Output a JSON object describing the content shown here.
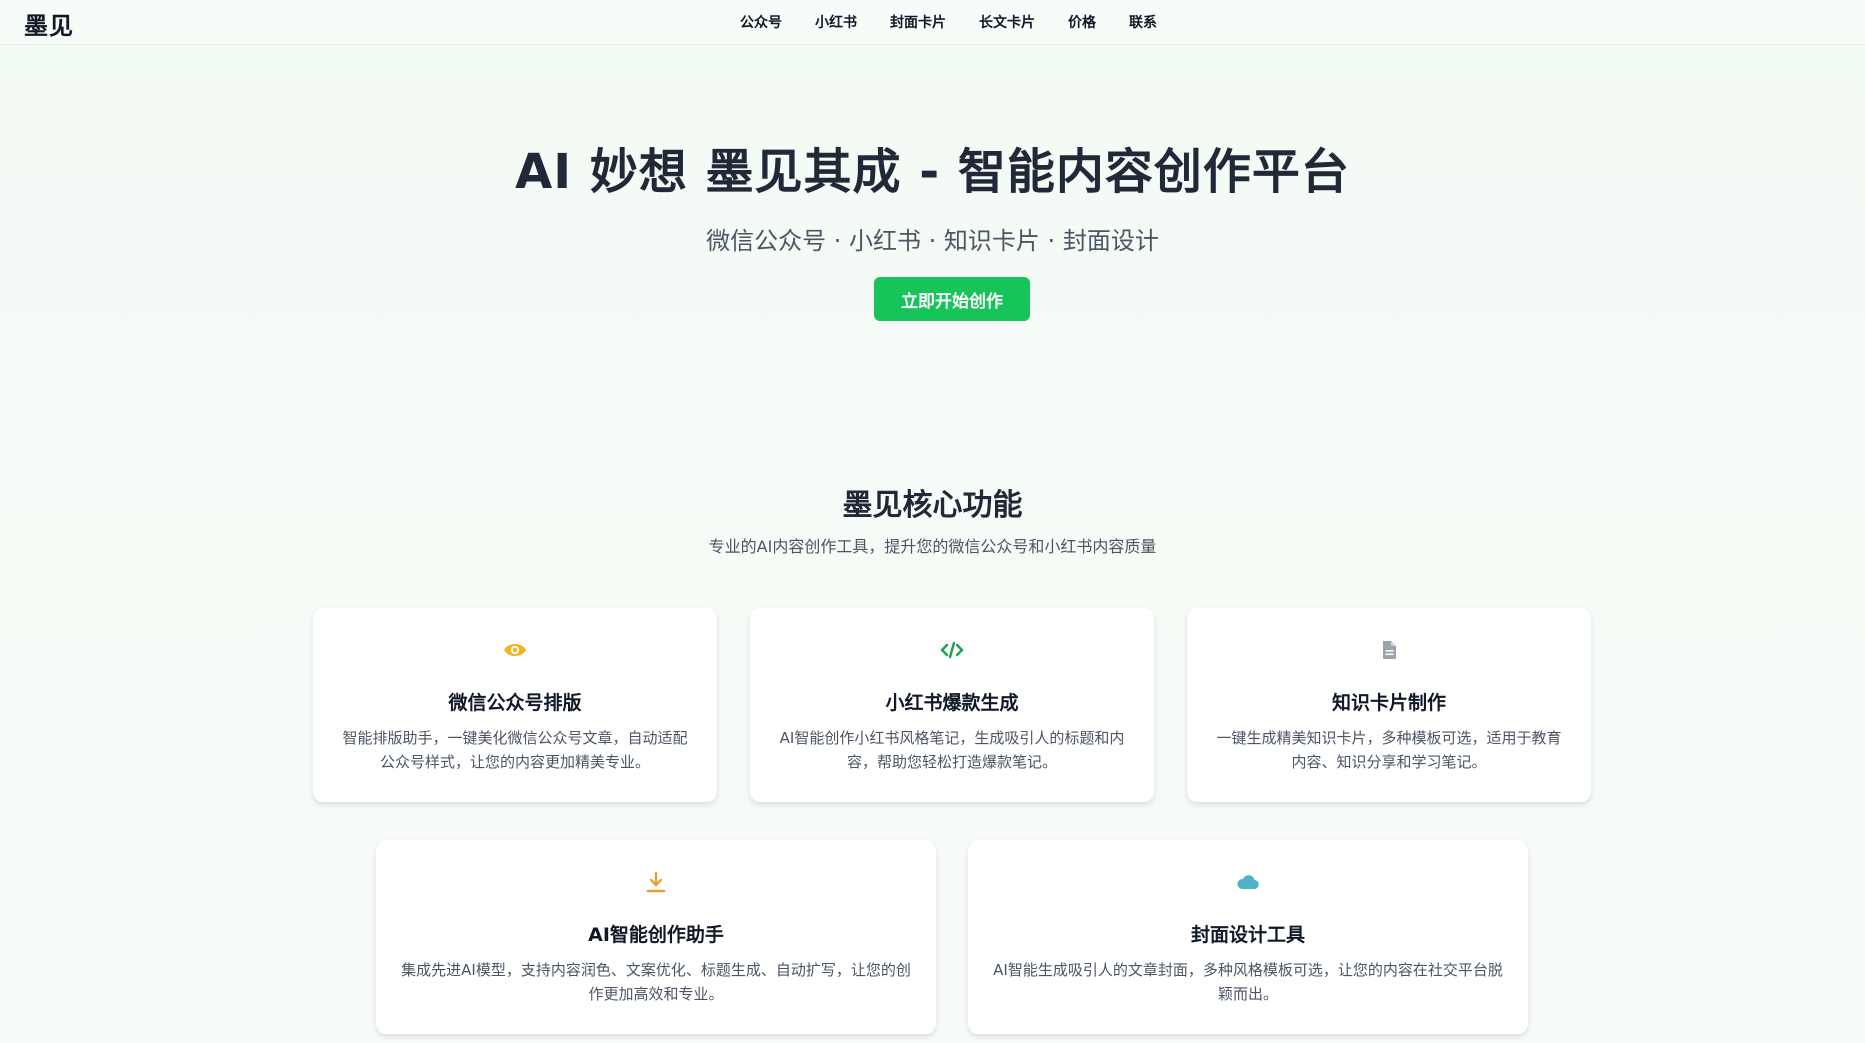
{
  "logo": "墨见",
  "nav": [
    "公众号",
    "小红书",
    "封面卡片",
    "长文卡片",
    "价格",
    "联系"
  ],
  "hero": {
    "title": "AI 妙想 墨见其成 - 智能内容创作平台",
    "subtitle": "微信公众号 · 小红书 · 知识卡片 · 封面设计",
    "cta": "立即开始创作"
  },
  "features": {
    "title": "墨见核心功能",
    "subtitle": "专业的AI内容创作工具，提升您的微信公众号和小红书内容质量",
    "cards": [
      {
        "icon": "eye-icon",
        "color": "#f5b21b",
        "title": "微信公众号排版",
        "desc": "智能排版助手，一键美化微信公众号文章，自动适配公众号样式，让您的内容更加精美专业。"
      },
      {
        "icon": "code-icon",
        "color": "#16a34a",
        "title": "小红书爆款生成",
        "desc": "AI智能创作小红书风格笔记，生成吸引人的标题和内容，帮助您轻松打造爆款笔记。"
      },
      {
        "icon": "document-icon",
        "color": "#9ca3af",
        "title": "知识卡片制作",
        "desc": "一键生成精美知识卡片，多种模板可选，适用于教育内容、知识分享和学习笔记。"
      },
      {
        "icon": "download-icon",
        "color": "#e3a431",
        "title": "AI智能创作助手",
        "desc": "集成先进AI模型，支持内容润色、文案优化、标题生成、自动扩写，让您的创作更加高效和专业。"
      },
      {
        "icon": "cloud-icon",
        "color": "#4fb3c8",
        "title": "封面设计工具",
        "desc": "AI智能生成吸引人的文章封面，多种风格模板可选，让您的内容在社交平台脱颖而出。"
      }
    ]
  }
}
